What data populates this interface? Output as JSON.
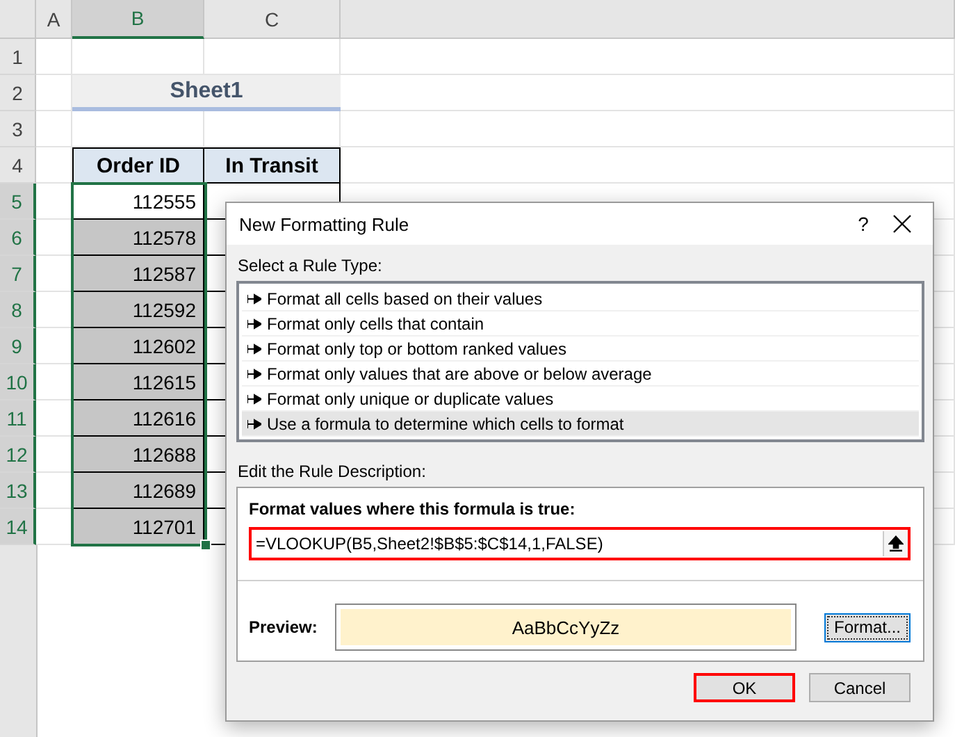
{
  "columns": [
    {
      "label": "A",
      "selected": false
    },
    {
      "label": "B",
      "selected": true
    },
    {
      "label": "C",
      "selected": false
    }
  ],
  "rows": [
    {
      "label": "1",
      "selected": false
    },
    {
      "label": "2",
      "selected": false
    },
    {
      "label": "3",
      "selected": false
    },
    {
      "label": "4",
      "selected": false
    },
    {
      "label": "5",
      "selected": true
    },
    {
      "label": "6",
      "selected": true
    },
    {
      "label": "7",
      "selected": true
    },
    {
      "label": "8",
      "selected": true
    },
    {
      "label": "9",
      "selected": true
    },
    {
      "label": "10",
      "selected": true
    },
    {
      "label": "11",
      "selected": true
    },
    {
      "label": "12",
      "selected": true
    },
    {
      "label": "13",
      "selected": true
    },
    {
      "label": "14",
      "selected": true
    }
  ],
  "sheet_title": "Sheet1",
  "table": {
    "headers": [
      "Order ID",
      "In Transit"
    ],
    "order_ids": [
      {
        "value": "112555",
        "shaded": false
      },
      {
        "value": "112578",
        "shaded": true
      },
      {
        "value": "112587",
        "shaded": true
      },
      {
        "value": "112592",
        "shaded": true
      },
      {
        "value": "112602",
        "shaded": true
      },
      {
        "value": "112615",
        "shaded": true
      },
      {
        "value": "112616",
        "shaded": true
      },
      {
        "value": "112688",
        "shaded": true
      },
      {
        "value": "112689",
        "shaded": true
      },
      {
        "value": "112701",
        "shaded": true
      }
    ]
  },
  "dialog": {
    "title": "New Formatting Rule",
    "help": "?",
    "rule_type_label": "Select a Rule Type:",
    "rule_types": [
      {
        "label": "Format all cells based on their values",
        "selected": false
      },
      {
        "label": "Format only cells that contain",
        "selected": false
      },
      {
        "label": "Format only top or bottom ranked values",
        "selected": false
      },
      {
        "label": "Format only values that are above or below average",
        "selected": false
      },
      {
        "label": "Format only unique or duplicate values",
        "selected": false
      },
      {
        "label": "Use a formula to determine which cells to format",
        "selected": true
      }
    ],
    "description_label": "Edit the Rule Description:",
    "formula_label": "Format values where this formula is true:",
    "formula": {
      "value": "=VLOOKUP(B5,Sheet2!$B$5:$C$14,1,FALSE)",
      "highlighted": true
    },
    "preview_label": "Preview:",
    "preview_sample": "AaBbCcYyZz",
    "format_button": "Format...",
    "buttons": [
      {
        "label": "OK",
        "highlighted": true
      },
      {
        "label": "Cancel",
        "highlighted": false
      }
    ]
  }
}
